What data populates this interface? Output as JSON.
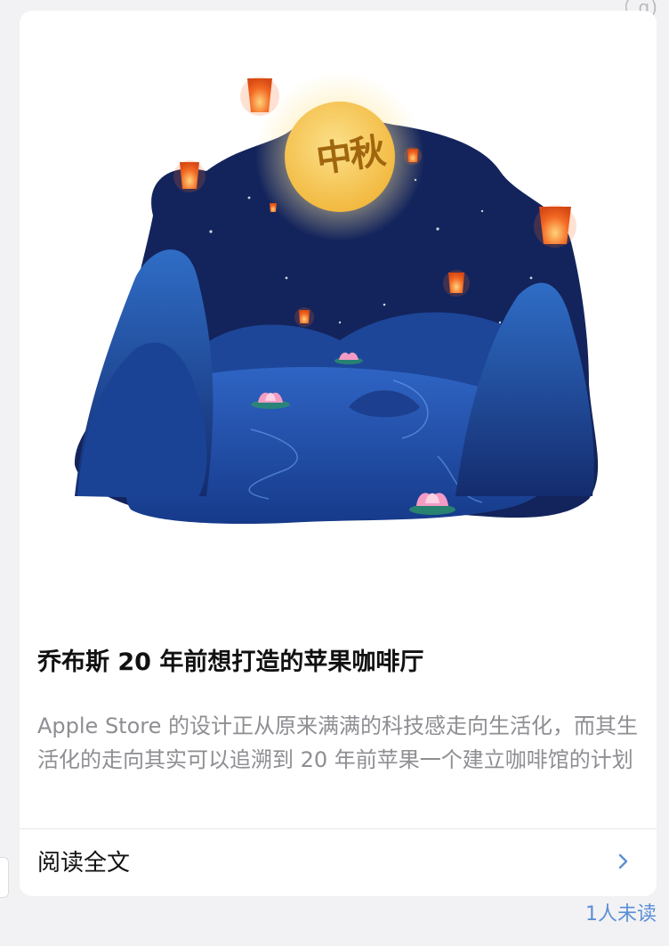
{
  "top_fragment": "（  g)",
  "card": {
    "moon_text": "中秋",
    "title": "乔布斯 20 年前想打造的苹果咖啡厅",
    "description": "Apple Store 的设计正从原来满满的科技感走向生活化，而其生活化的走向其实可以追溯到 20 年前苹果一个建立咖啡馆的计划",
    "read_full": "阅读全文",
    "chevron_icon": "chevron-right-icon"
  },
  "unread_badge": "1人未读",
  "colors": {
    "background": "#f2f2f4",
    "card": "#ffffff",
    "night_sky": "#13245c",
    "moon": "#f6c95a",
    "link_blue": "#5b8fd6",
    "lantern": "#f36a24"
  }
}
